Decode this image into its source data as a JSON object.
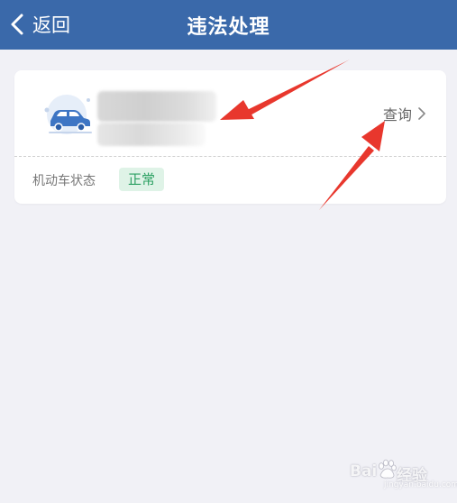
{
  "header": {
    "back_label": "返回",
    "title": "违法处理",
    "background_color": "#3a69aa"
  },
  "vehicle_card": {
    "icon": "car-icon",
    "plate_text": "",
    "owner_text": "",
    "action_label": "查询",
    "action_icon": "chevron-right-icon",
    "status_label": "机动车状态",
    "status_value": "正常",
    "status_color": "#2ba062"
  },
  "watermark": {
    "text_left": "Bai",
    "text_right": "经验",
    "sub": "jingyan.baidu.com"
  }
}
